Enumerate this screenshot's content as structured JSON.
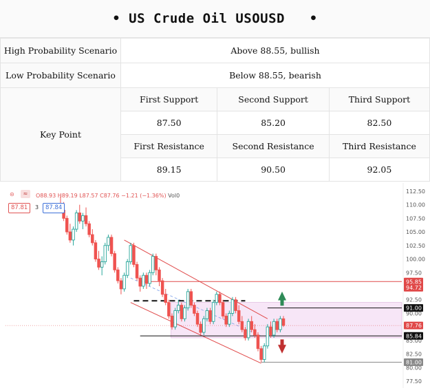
{
  "title": "US Crude Oil USOUSD",
  "scenario": {
    "high_label": "High Probability Scenario",
    "high_value": "Above 88.55, bullish",
    "low_label": "Low Probability Scenario",
    "low_value": "Below 88.55, bearish"
  },
  "key_point": {
    "label": "Key Point",
    "support_headers": [
      "First Support",
      "Second Support",
      "Third Support"
    ],
    "support_values": [
      "87.50",
      "85.20",
      "82.50"
    ],
    "resistance_headers": [
      "First Resistance",
      "Second Resistance",
      "Third Resistance"
    ],
    "resistance_values": [
      "89.15",
      "90.50",
      "92.05"
    ]
  },
  "chart_header": {
    "open": "O88.93",
    "high": "H89.19",
    "low": "L87.57",
    "close": "C87.76",
    "change": "−1.21 (−1.36%)",
    "volume": "Vol0",
    "bid": "87.81",
    "spread": "3",
    "ask": "87.84"
  },
  "chart_data": {
    "type": "candlestick",
    "ylim": [
      76.5,
      113.5
    ],
    "y_ticks": [
      "77.50",
      "80.00",
      "82.50",
      "85.00",
      "87.50",
      "90.00",
      "92.50",
      "95.00",
      "97.50",
      "100.00",
      "102.50",
      "105.00",
      "107.50",
      "110.00",
      "112.50"
    ],
    "price_labels": [
      {
        "text": "95.85",
        "value": 95.85,
        "color": "#e04848"
      },
      {
        "text": "94.72",
        "value": 94.72,
        "color": "#e04848"
      },
      {
        "text": "91.00",
        "value": 91.0,
        "color": "#111111"
      },
      {
        "text": "87.76",
        "value": 87.76,
        "color": "#e04848"
      },
      {
        "text": "85.84",
        "value": 85.84,
        "color": "#111111"
      },
      {
        "text": "81.00",
        "value": 81.0,
        "color": "#888888"
      }
    ],
    "levels": [
      {
        "value": 95.85,
        "color": "#e04848",
        "style": "solid"
      },
      {
        "value": 91.0,
        "color": "#111111",
        "style": "solid"
      },
      {
        "value": 85.84,
        "color": "#111111",
        "style": "solid"
      },
      {
        "value": 81.0,
        "color": "#888888",
        "style": "solid"
      },
      {
        "value": 92.3,
        "color": "#111111",
        "style": "dashed"
      }
    ],
    "zone": {
      "top": 92.0,
      "bottom": 85.5
    },
    "candles": [
      [
        110.0,
        111.5,
        108.5,
        109.0
      ],
      [
        109.0,
        110.5,
        107.0,
        107.5
      ],
      [
        107.5,
        108.0,
        104.5,
        105.0
      ],
      [
        105.0,
        106.5,
        103.0,
        103.5
      ],
      [
        103.5,
        106.0,
        102.5,
        105.5
      ],
      [
        105.5,
        109.0,
        105.0,
        108.5
      ],
      [
        108.5,
        110.0,
        106.5,
        107.0
      ],
      [
        107.0,
        108.5,
        105.5,
        108.0
      ],
      [
        108.0,
        109.5,
        106.0,
        106.5
      ],
      [
        106.5,
        107.0,
        104.0,
        104.5
      ],
      [
        104.5,
        105.5,
        102.5,
        103.0
      ],
      [
        103.0,
        103.5,
        99.5,
        100.0
      ],
      [
        100.0,
        101.5,
        98.0,
        98.5
      ],
      [
        98.5,
        100.5,
        97.0,
        99.5
      ],
      [
        99.5,
        103.0,
        99.0,
        102.5
      ],
      [
        102.5,
        104.5,
        101.5,
        104.0
      ],
      [
        104.0,
        104.5,
        100.5,
        101.0
      ],
      [
        101.0,
        101.5,
        97.5,
        98.0
      ],
      [
        98.0,
        98.5,
        95.5,
        96.0
      ],
      [
        96.0,
        96.5,
        93.5,
        94.5
      ],
      [
        94.5,
        97.5,
        94.0,
        97.0
      ],
      [
        97.0,
        100.0,
        96.5,
        99.5
      ],
      [
        99.5,
        103.0,
        99.0,
        102.5
      ],
      [
        102.5,
        103.0,
        98.5,
        99.0
      ],
      [
        99.0,
        99.5,
        96.0,
        96.5
      ],
      [
        96.5,
        97.0,
        94.0,
        95.0
      ],
      [
        95.0,
        97.5,
        94.5,
        97.0
      ],
      [
        97.0,
        97.5,
        94.5,
        95.5
      ],
      [
        95.5,
        98.0,
        95.0,
        97.5
      ],
      [
        97.5,
        101.0,
        97.0,
        100.5
      ],
      [
        100.5,
        101.0,
        97.0,
        98.0
      ],
      [
        98.0,
        98.5,
        95.0,
        96.0
      ],
      [
        96.0,
        96.5,
        93.0,
        93.5
      ],
      [
        93.5,
        94.5,
        91.5,
        92.0
      ],
      [
        92.0,
        92.5,
        89.0,
        89.5
      ],
      [
        89.5,
        90.0,
        87.0,
        87.5
      ],
      [
        87.5,
        91.0,
        87.0,
        90.5
      ],
      [
        90.5,
        92.5,
        90.0,
        91.5
      ],
      [
        91.5,
        92.0,
        88.5,
        89.0
      ],
      [
        89.0,
        91.5,
        88.5,
        91.0
      ],
      [
        91.0,
        94.5,
        90.5,
        94.0
      ],
      [
        94.0,
        94.5,
        91.0,
        91.5
      ],
      [
        91.5,
        92.0,
        89.5,
        90.0
      ],
      [
        90.0,
        90.5,
        87.5,
        88.0
      ],
      [
        88.0,
        88.5,
        86.0,
        86.5
      ],
      [
        86.5,
        89.5,
        86.0,
        89.0
      ],
      [
        89.0,
        91.0,
        88.5,
        90.5
      ],
      [
        90.5,
        91.0,
        88.0,
        88.5
      ],
      [
        88.5,
        92.5,
        88.0,
        92.0
      ],
      [
        92.0,
        94.0,
        91.5,
        93.5
      ],
      [
        93.5,
        94.0,
        91.5,
        92.0
      ],
      [
        92.0,
        92.5,
        89.0,
        89.5
      ],
      [
        89.5,
        90.0,
        87.5,
        88.0
      ],
      [
        88.0,
        90.5,
        87.5,
        90.0
      ],
      [
        90.0,
        93.0,
        89.5,
        92.5
      ],
      [
        92.5,
        93.0,
        90.0,
        90.5
      ],
      [
        90.5,
        91.5,
        88.0,
        88.5
      ],
      [
        88.5,
        89.5,
        86.5,
        87.0
      ],
      [
        87.0,
        87.5,
        85.0,
        85.5
      ],
      [
        85.5,
        89.0,
        85.0,
        88.5
      ],
      [
        88.5,
        89.5,
        86.5,
        87.0
      ],
      [
        87.0,
        88.0,
        85.5,
        86.0
      ],
      [
        86.0,
        86.5,
        83.0,
        83.5
      ],
      [
        83.5,
        84.0,
        81.0,
        81.5
      ],
      [
        81.5,
        84.5,
        81.0,
        84.0
      ],
      [
        84.0,
        88.0,
        83.5,
        87.5
      ],
      [
        87.5,
        88.5,
        85.5,
        86.0
      ],
      [
        86.0,
        89.0,
        85.5,
        88.5
      ],
      [
        88.5,
        89.0,
        86.5,
        87.0
      ],
      [
        87.0,
        89.5,
        86.5,
        89.0
      ],
      [
        89.0,
        89.5,
        87.5,
        87.76
      ]
    ]
  },
  "arrows": {
    "up_color": "#2e8b57",
    "down_color": "#c03030"
  }
}
